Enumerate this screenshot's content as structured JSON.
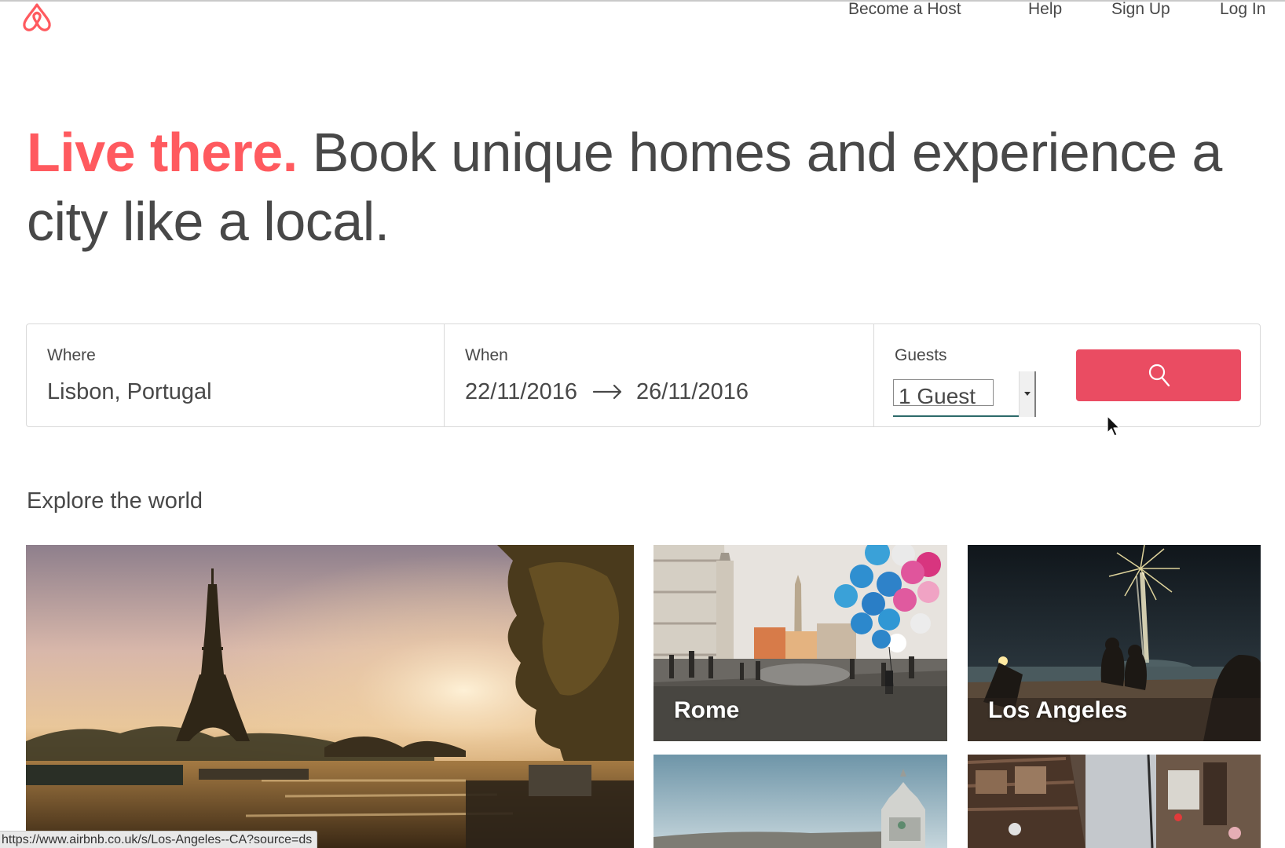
{
  "header": {
    "logo_icon": "airbnb-belo-icon",
    "nav": {
      "become_host": "Become a Host",
      "help": "Help",
      "sign_up": "Sign Up",
      "log_in": "Log In"
    }
  },
  "hero": {
    "accent": "Live there.",
    "rest": "Book unique homes and experience a city like a local."
  },
  "search": {
    "where": {
      "label": "Where",
      "value": "Lisbon, Portugal"
    },
    "when": {
      "label": "When",
      "from": "22/11/2016",
      "to": "26/11/2016"
    },
    "guests": {
      "label": "Guests",
      "value": "1 Guest"
    },
    "button_icon": "search-icon"
  },
  "explore": {
    "title": "Explore the world",
    "tiles": [
      {
        "label": ""
      },
      {
        "label": "Rome"
      },
      {
        "label": "Los Angeles"
      },
      {
        "label": ""
      },
      {
        "label": ""
      }
    ]
  },
  "status_bar": {
    "url": "https://www.airbnb.co.uk/s/Los-Angeles--CA?source=ds"
  },
  "colors": {
    "brand": "#ff5a5f",
    "search_button": "#ea4c62",
    "text": "#484848"
  }
}
